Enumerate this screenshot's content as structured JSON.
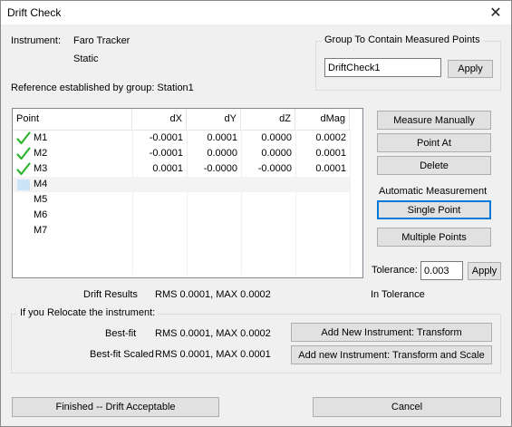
{
  "window": {
    "title": "Drift Check",
    "close_symbol": "✕"
  },
  "instrument": {
    "label": "Instrument:",
    "name": "Faro Tracker",
    "state": "Static"
  },
  "reference": "Reference established by group: Station1",
  "group": {
    "legend": "Group To Contain Measured Points",
    "value": "DriftCheck1",
    "apply_label": "Apply"
  },
  "table": {
    "columns": [
      "Point",
      "dX",
      "dY",
      "dZ",
      "dMag"
    ],
    "rows": [
      {
        "point": "M1",
        "dx": "-0.0001",
        "dy": "0.0001",
        "dz": "0.0000",
        "dmag": "0.0002",
        "status": "ok"
      },
      {
        "point": "M2",
        "dx": "-0.0001",
        "dy": "0.0000",
        "dz": "0.0000",
        "dmag": "0.0001",
        "status": "ok"
      },
      {
        "point": "M3",
        "dx": "0.0001",
        "dy": "-0.0000",
        "dz": "-0.0000",
        "dmag": "0.0001",
        "status": "ok"
      },
      {
        "point": "M4",
        "dx": "",
        "dy": "",
        "dz": "",
        "dmag": "",
        "status": "selected"
      },
      {
        "point": "M5",
        "dx": "",
        "dy": "",
        "dz": "",
        "dmag": "",
        "status": "none"
      },
      {
        "point": "M6",
        "dx": "",
        "dy": "",
        "dz": "",
        "dmag": "",
        "status": "none"
      },
      {
        "point": "M7",
        "dx": "",
        "dy": "",
        "dz": "",
        "dmag": "",
        "status": "none"
      }
    ]
  },
  "actions": {
    "measure_manually": "Measure Manually",
    "point_at": "Point At",
    "delete": "Delete"
  },
  "automatic": {
    "legend": "Automatic Measurement",
    "single_point": "Single Point",
    "multiple_points": "Multiple Points"
  },
  "tolerance": {
    "label": "Tolerance:",
    "value": "0.003",
    "apply_label": "Apply"
  },
  "drift_results": {
    "label": "Drift Results",
    "value": "RMS 0.0001, MAX 0.0002",
    "status": "In Tolerance"
  },
  "relocate": {
    "legend": "If you Relocate the instrument:",
    "bestfit_label": "Best-fit",
    "bestfit_value": "RMS 0.0001, MAX 0.0002",
    "scaled_label": "Best-fit Scaled",
    "scaled_value": "RMS 0.0001, MAX 0.0001",
    "add_transform": "Add New Instrument: Transform",
    "add_transform_scale": "Add new Instrument: Transform and Scale"
  },
  "footer": {
    "finished": "Finished -- Drift Acceptable",
    "cancel": "Cancel"
  },
  "colors": {
    "check": "#2fb52f",
    "selection": "#cce4f7",
    "accent": "#0078d7"
  }
}
